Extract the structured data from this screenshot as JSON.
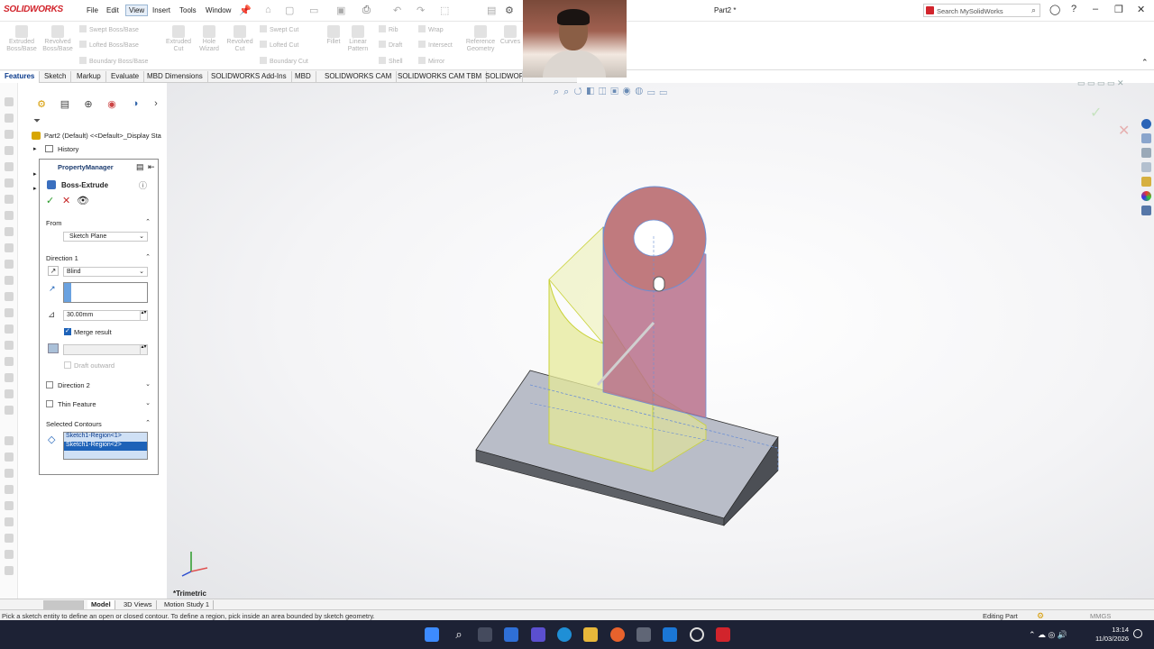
{
  "app": {
    "logo": "SOLIDWORKS",
    "doc_title": "Part2 *",
    "search_placeholder": "Search MySolidWorks"
  },
  "menu": [
    "File",
    "Edit",
    "View",
    "Insert",
    "Tools",
    "Window"
  ],
  "command_manager": {
    "large": [
      "Extruded Boss/Base",
      "Revolved Boss/Base",
      "Extruded Cut",
      "Hole Wizard",
      "Revolved Cut",
      "Fillet",
      "Linear Pattern",
      "Reference Geometry",
      "Curves"
    ],
    "small": [
      "Swept Boss/Base",
      "Lofted Boss/Base",
      "Boundary Boss/Base",
      "Swept Cut",
      "Lofted Cut",
      "Boundary Cut",
      "Rib",
      "Draft",
      "Shell",
      "Wrap",
      "Intersect",
      "Mirror"
    ]
  },
  "tabs": [
    "Features",
    "Sketch",
    "Markup",
    "Evaluate",
    "MBD Dimensions",
    "SOLIDWORKS Add-Ins",
    "MBD",
    "SOLIDWORKS CAM",
    "SOLIDWORKS CAM TBM",
    "SOLIDWORKS Inspection"
  ],
  "tree": {
    "part": "Part2 (Default) <<Default>_Display Sta",
    "history": "History"
  },
  "property_manager": {
    "title": "PropertyManager",
    "feature": "Boss-Extrude",
    "from_label": "From",
    "from_value": "Sketch Plane",
    "dir1_label": "Direction 1",
    "end_condition": "Blind",
    "depth": "30.00mm",
    "merge_result": "Merge result",
    "draft_outward": "Draft outward",
    "dir2_label": "Direction 2",
    "thin_label": "Thin Feature",
    "contours_label": "Selected Contours",
    "contours": [
      "Sketch1-Region<1>",
      "Sketch1-Region<2>"
    ]
  },
  "view_label": "*Trimetric",
  "bottom_tabs": [
    "Model",
    "3D Views",
    "Motion Study 1"
  ],
  "status": {
    "message": "Pick a sketch entity to define an open or closed contour. To define a region, pick inside an area bounded by sketch geometry.",
    "mode": "Editing Part",
    "units": "MMGS"
  },
  "clock": {
    "time": "13:14",
    "date": "11/03/2026"
  },
  "colors": {
    "accent": "#d2242c",
    "selection": "#1d62b8",
    "preview_yellow": "#e9ec9a",
    "preview_magenta": "#b8708a",
    "base_top": "#b8bcc8",
    "base_side": "#55585e"
  }
}
